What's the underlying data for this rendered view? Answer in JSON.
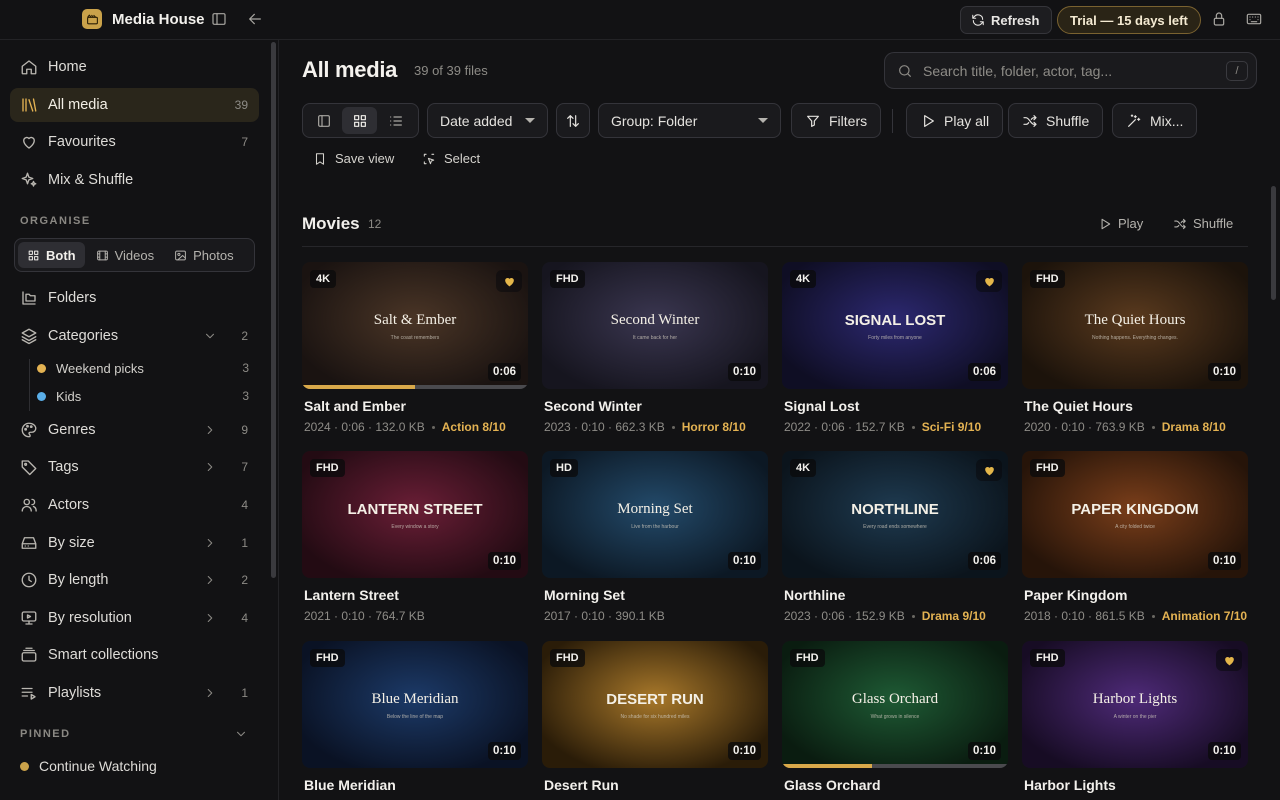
{
  "app": {
    "name": "Media House"
  },
  "topbar": {
    "refresh_label": "Refresh",
    "trial_label": "Trial — 15 days left"
  },
  "sidebar": {
    "nav": [
      {
        "label": "Home",
        "count": ""
      },
      {
        "label": "All media",
        "count": "39"
      },
      {
        "label": "Favourites",
        "count": "7"
      },
      {
        "label": "Mix & Shuffle",
        "count": ""
      }
    ],
    "organise_label": "ORGANISE",
    "media_filter": {
      "both": "Both",
      "videos": "Videos",
      "photos": "Photos",
      "selected": "Both"
    },
    "library": [
      {
        "label": "Folders",
        "count": ""
      },
      {
        "label": "Categories",
        "count": "2"
      },
      {
        "label": "Genres",
        "count": "9"
      },
      {
        "label": "Tags",
        "count": "7"
      },
      {
        "label": "Actors",
        "count": "4"
      },
      {
        "label": "By size",
        "count": "1"
      },
      {
        "label": "By length",
        "count": "2"
      },
      {
        "label": "By resolution",
        "count": "4"
      },
      {
        "label": "Smart collections",
        "count": ""
      },
      {
        "label": "Playlists",
        "count": "1"
      }
    ],
    "categories": [
      {
        "label": "Weekend picks",
        "count": "3",
        "color": "#e3b252"
      },
      {
        "label": "Kids",
        "count": "3",
        "color": "#5aaee8"
      }
    ],
    "pinned_label": "PINNED",
    "pinned": [
      {
        "label": "Continue Watching",
        "color": "#caa24a"
      }
    ]
  },
  "main": {
    "title": "All media",
    "file_count": "39 of 39 files",
    "search": {
      "placeholder": "Search title, folder, actor, tag...",
      "shortcut": "/"
    },
    "toolbar": {
      "sort": "Date added",
      "group": "Group: Folder",
      "filters": "Filters",
      "play_all": "Play all",
      "shuffle": "Shuffle",
      "mix": "Mix...",
      "save_view": "Save view",
      "select": "Select",
      "view_mode": "grid"
    },
    "group": {
      "name": "Movies",
      "count": "12",
      "play": "Play",
      "shuffle": "Shuffle"
    },
    "items": [
      {
        "title": "Salt and Ember",
        "poster_title": "Salt & Ember",
        "poster_tag": "The coast remembers",
        "res": "4K",
        "duration": "0:06",
        "year": "2024",
        "size": "132.0 KB",
        "genre": "Action 8/10",
        "fav": true,
        "progress": 0.5,
        "c1": "#4a3526",
        "c2": "#1a1311"
      },
      {
        "title": "Second Winter",
        "poster_title": "Second Winter",
        "poster_tag": "It came back for her",
        "res": "FHD",
        "duration": "0:10",
        "year": "2023",
        "size": "662.3 KB",
        "genre": "Horror 8/10",
        "fav": false,
        "progress": 0,
        "c1": "#3a3650",
        "c2": "#16151f"
      },
      {
        "title": "Signal Lost",
        "poster_title": "SIGNAL LOST",
        "poster_tag": "Forty miles from anyone",
        "res": "4K",
        "duration": "0:06",
        "year": "2022",
        "size": "152.7 KB",
        "genre": "Sci-Fi 9/10",
        "fav": true,
        "progress": 0,
        "c1": "#2c2870",
        "c2": "#0f0e24"
      },
      {
        "title": "The Quiet Hours",
        "poster_title": "The Quiet Hours",
        "poster_tag": "Nothing happens. Everything changes.",
        "res": "FHD",
        "duration": "0:10",
        "year": "2020",
        "size": "763.9 KB",
        "genre": "Drama 8/10",
        "fav": false,
        "progress": 0,
        "c1": "#5a3a1e",
        "c2": "#1c130b"
      },
      {
        "title": "Lantern Street",
        "poster_title": "LANTERN STREET",
        "poster_tag": "Every window a story",
        "res": "FHD",
        "duration": "0:10",
        "year": "2021",
        "size": "764.7 KB",
        "genre": "",
        "fav": false,
        "progress": 0,
        "c1": "#6a1e36",
        "c2": "#230b13"
      },
      {
        "title": "Morning Set",
        "poster_title": "Morning Set",
        "poster_tag": "Live from the harbour",
        "res": "HD",
        "duration": "0:10",
        "year": "2017",
        "size": "390.1 KB",
        "genre": "",
        "fav": false,
        "progress": 0,
        "c1": "#234a6a",
        "c2": "#0c1824"
      },
      {
        "title": "Northline",
        "poster_title": "NORTHLINE",
        "poster_tag": "Every road ends somewhere",
        "res": "4K",
        "duration": "0:06",
        "year": "2023",
        "size": "152.9 KB",
        "genre": "Drama 9/10",
        "fav": true,
        "progress": 0,
        "c1": "#1e3a50",
        "c2": "#0b141c"
      },
      {
        "title": "Paper Kingdom",
        "poster_title": "PAPER KINGDOM",
        "poster_tag": "A city folded twice",
        "res": "FHD",
        "duration": "0:10",
        "year": "2018",
        "size": "861.5 KB",
        "genre": "Animation 7/10",
        "fav": false,
        "progress": 0,
        "c1": "#7a3e1a",
        "c2": "#261409"
      },
      {
        "title": "Blue Meridian",
        "poster_title": "Blue Meridian",
        "poster_tag": "Below the line of the map",
        "res": "FHD",
        "duration": "0:10",
        "year": "",
        "size": "",
        "genre": "",
        "fav": false,
        "progress": 0,
        "c1": "#1c3a68",
        "c2": "#0a1224"
      },
      {
        "title": "Desert Run",
        "poster_title": "DESERT RUN",
        "poster_tag": "No shade for six hundred miles",
        "res": "FHD",
        "duration": "0:10",
        "year": "",
        "size": "",
        "genre": "",
        "fav": false,
        "progress": 0,
        "c1": "#a8782a",
        "c2": "#2a1c08"
      },
      {
        "title": "Glass Orchard",
        "poster_title": "Glass Orchard",
        "poster_tag": "What grows in silence",
        "res": "FHD",
        "duration": "0:10",
        "year": "",
        "size": "",
        "genre": "",
        "fav": false,
        "progress": 0.4,
        "c1": "#1e5a34",
        "c2": "#0a1c10"
      },
      {
        "title": "Harbor Lights",
        "poster_title": "Harbor Lights",
        "poster_tag": "A winter on the pier",
        "res": "FHD",
        "duration": "0:10",
        "year": "",
        "size": "",
        "genre": "",
        "fav": true,
        "progress": 0,
        "c1": "#4e2a78",
        "c2": "#170c24"
      }
    ]
  }
}
